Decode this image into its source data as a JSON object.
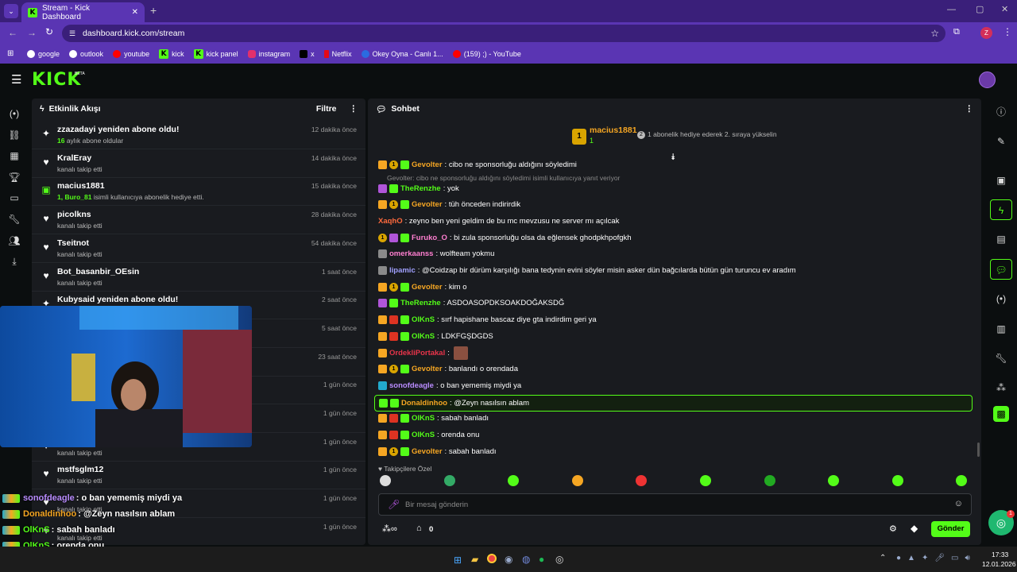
{
  "browser": {
    "tab_title": "Stream - Kick Dashboard",
    "url": "dashboard.kick.com/stream",
    "profile_initial": "Z",
    "bookmarks": [
      "google",
      "outlook",
      "youtube",
      "kick",
      "kick panel",
      "instagram",
      "x",
      "Netflix",
      "Okey Oyna - Canlı 1...",
      "(159) ;) - YouTube"
    ]
  },
  "header": {
    "logo": "KICK",
    "beta": "BETA"
  },
  "activity": {
    "title": "Etkinlik Akışı",
    "filter_label": "Filtre",
    "items": [
      {
        "name": "zzazadayi yeniden abone oldu!",
        "sub_strong": "16",
        "sub": " aylık abone oldular",
        "time": "12 dakika önce",
        "icon": "sparkle"
      },
      {
        "name": "KralEray",
        "sub_strong": "",
        "sub": "kanalı takip etti",
        "time": "14 dakika önce",
        "icon": "heart"
      },
      {
        "name": "macius1881",
        "sub_strong": "1, Buro_81",
        "sub": " isimli kullanıcıya abonelik hediye etti.",
        "time": "15 dakika önce",
        "icon": "gift"
      },
      {
        "name": "picolkns",
        "sub_strong": "",
        "sub": "kanalı takip etti",
        "time": "28 dakika önce",
        "icon": "heart"
      },
      {
        "name": "Tseitnot",
        "sub_strong": "",
        "sub": "kanalı takip etti",
        "time": "54 dakika önce",
        "icon": "heart"
      },
      {
        "name": "Bot_basanbir_OEsin",
        "sub_strong": "",
        "sub": "kanalı takip etti",
        "time": "1 saat önce",
        "icon": "heart"
      },
      {
        "name": "Kubysaid yeniden abone oldu!",
        "sub_strong": "",
        "sub": "",
        "time": "2 saat önce",
        "icon": "sparkle"
      },
      {
        "name": "",
        "sub_strong": "",
        "sub": "",
        "time": "5 saat önce",
        "icon": "heart"
      },
      {
        "name": "",
        "sub_strong": "",
        "sub": "",
        "time": "23 saat önce",
        "icon": "heart"
      },
      {
        "name": "",
        "sub_strong": "",
        "sub": "",
        "time": "1 gün önce",
        "icon": "heart"
      },
      {
        "name": "",
        "sub_strong": "",
        "sub": "",
        "time": "1 gün önce",
        "icon": "heart"
      },
      {
        "name": "",
        "sub_strong": "",
        "sub": "kanalı takip etti",
        "time": "1 gün önce",
        "icon": "heart"
      },
      {
        "name": "mstfsglm12",
        "sub_strong": "",
        "sub": "kanalı takip etti",
        "time": "1 gün önce",
        "icon": "heart"
      },
      {
        "name": "",
        "sub_strong": "",
        "sub": "kanalı takip etti",
        "time": "1 gün önce",
        "icon": "heart"
      },
      {
        "name": "",
        "sub_strong": "",
        "sub": "kanalı takip etti",
        "time": "1 gün önce",
        "icon": "heart"
      }
    ]
  },
  "chat": {
    "title": "Sohbet",
    "pinned_user": "macius1881",
    "pinned_rank": "1",
    "pinned_count": "1",
    "pinned_hint_num": "2",
    "pinned_hint": "1 abonelik hediye ederek 2. sıraya yükselin",
    "reply_line": "Gevolter: cibo ne sponsorluğu aldığını söyledimi isimli kullanıcıya yanıt veriyor",
    "messages": [
      {
        "badges": [
          "cr",
          "co",
          "gf"
        ],
        "user": "Gevolter",
        "color": "#f5a623",
        "text": ": cibo ne sponsorluğu aldığını söyledimi"
      },
      {
        "badges": [
          "pu",
          "gf"
        ],
        "user": "TheRenzhe",
        "color": "#53fc18",
        "text": ": yok"
      },
      {
        "badges": [
          "cr",
          "co",
          "gf"
        ],
        "user": "Gevolter",
        "color": "#f5a623",
        "text": ": tüh önceden indirirdik"
      },
      {
        "badges": [],
        "user": "XaqhO",
        "color": "#ff6a3d",
        "text": ": zeyno ben yeni geldim de bu mc mevzusu ne server mı açılcak"
      },
      {
        "badges": [
          "co",
          "pu",
          "gf"
        ],
        "user": "Furuko_O",
        "color": "#ff7fd0",
        "text": ": bi zula sponsorluğu olsa da eğlensek ghodpkhpofgkh"
      },
      {
        "badges": [
          "gr"
        ],
        "user": "omerkaanss",
        "color": "#ff7fd0",
        "text": ": wolfteam yokmu"
      },
      {
        "badges": [
          "gr"
        ],
        "user": "lipamic",
        "color": "#a0a0ff",
        "text": ": @Coidzap bir dürüm karşılığı bana tedynin evini söyler misin asker dün bağcılarda bütün gün turuncu ev aradım"
      },
      {
        "badges": [
          "cr",
          "co",
          "gf"
        ],
        "user": "Gevolter",
        "color": "#f5a623",
        "text": ": kim o"
      },
      {
        "badges": [
          "pu",
          "gf"
        ],
        "user": "TheRenzhe",
        "color": "#53fc18",
        "text": ": ASDOASOPDKSOAKDOĞAKSDĞ"
      },
      {
        "badges": [
          "cr",
          "rd",
          "gf"
        ],
        "user": "OlKnS",
        "color": "#53fc18",
        "text": ": sırf hapishane bascaz diye gta indirdim geri ya"
      },
      {
        "badges": [
          "cr",
          "rd",
          "gf"
        ],
        "user": "OlKnS",
        "color": "#53fc18",
        "text": ": LDKFGŞDGDS"
      },
      {
        "badges": [
          "cr"
        ],
        "user": "OrdekliPortakal",
        "color": "#e8344a",
        "text": ":"
      },
      {
        "badges": [
          "cr",
          "co",
          "gf"
        ],
        "user": "Gevolter",
        "color": "#f5a623",
        "text": ": banlandı o orendada"
      },
      {
        "badges": [
          "cy"
        ],
        "user": "sonofdeagle",
        "color": "#b98cff",
        "text": ": o ban yememiş miydi ya"
      },
      {
        "badges": [
          "gf",
          "gf"
        ],
        "user": "Donaldinhoo",
        "color": "#f5a623",
        "text": ": @Zeyn nasılsın ablam",
        "highlight": true
      },
      {
        "badges": [
          "cr",
          "rd",
          "gf"
        ],
        "user": "OlKnS",
        "color": "#53fc18",
        "text": ": sabah banladı"
      },
      {
        "badges": [
          "cr",
          "rd",
          "gf"
        ],
        "user": "OlKnS",
        "color": "#53fc18",
        "text": ": orenda onu"
      },
      {
        "badges": [
          "cr",
          "co",
          "gf"
        ],
        "user": "Gevolter",
        "color": "#f5a623",
        "text": ": sabah banladı"
      }
    ],
    "followers_only": "Takipçilere Özel",
    "input_placeholder": "Bir mesaj gönderin",
    "points": "0",
    "send_label": "Gönder"
  },
  "overlay": [
    {
      "user": "sonofdeagle",
      "color": "#b98cff",
      "text": ": o ban yememiş miydi ya"
    },
    {
      "user": "Donaldinhoo",
      "color": "#f5a623",
      "text": ": @Zeyn nasılsın ablam"
    },
    {
      "user": "OlKnS",
      "color": "#53fc18",
      "text": ": sabah banladı"
    },
    {
      "user": "OlKnS",
      "color": "#53fc18",
      "text": ": orenda onu"
    },
    {
      "user": "Gevolter",
      "color": "#f5a623",
      "text": ": sabah banladı"
    }
  ],
  "taskbar": {
    "time": "17:33",
    "date": "12.01.2026"
  },
  "colors": {
    "accent": "#53fc18",
    "browser": "#5a35b3",
    "panel": "#191b1f"
  }
}
